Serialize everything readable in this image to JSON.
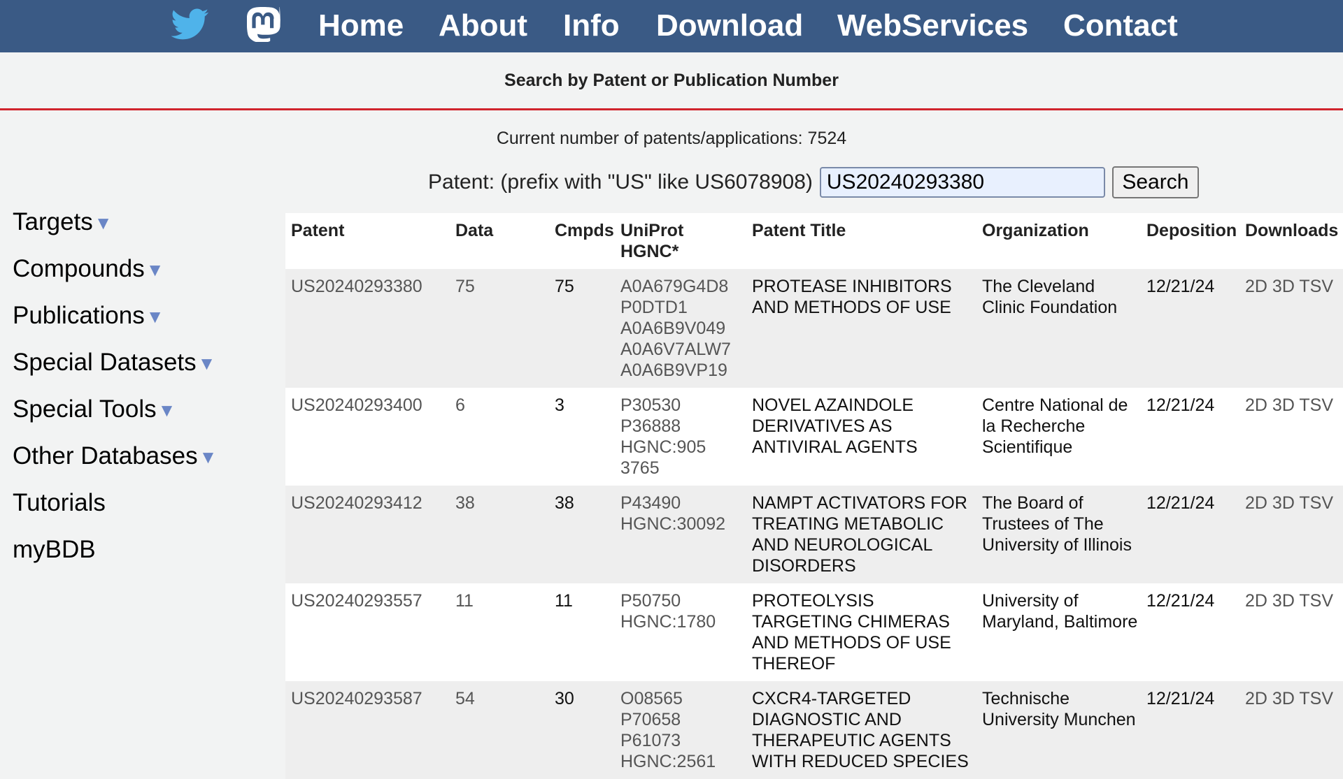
{
  "nav": {
    "icons": [
      "twitter-bird-icon",
      "mastodon-icon"
    ],
    "links": [
      "Home",
      "About",
      "Info",
      "Download",
      "WebServices",
      "Contact"
    ],
    "bg_color": "#3a5a85"
  },
  "subheader": {
    "title": "Search by Patent or Publication Number",
    "accent_color": "#d0242c"
  },
  "count_line": "Current number of patents/applications: 7524",
  "search": {
    "label": "Patent: (prefix with \"US\" like US6078908)",
    "value": "US20240293380",
    "button": "Search"
  },
  "sidebar": {
    "items": [
      {
        "label": "Targets",
        "dropdown": "▼"
      },
      {
        "label": "Compounds",
        "dropdown": "▼"
      },
      {
        "label": "Publications",
        "dropdown": "▼"
      },
      {
        "label": "Special Datasets",
        "dropdown": "▼"
      },
      {
        "label": "Special Tools",
        "dropdown": "▼"
      },
      {
        "label": "Other Databases",
        "dropdown": "▼"
      },
      {
        "label": "Tutorials",
        "dropdown": ""
      },
      {
        "label": "myBDB",
        "dropdown": ""
      }
    ]
  },
  "table": {
    "headers": [
      "Patent",
      "Data",
      "Cmpds",
      "UniProt\nHGNC*",
      "Patent Title",
      "Organization",
      "Deposition",
      "Downloads"
    ],
    "download_links": [
      "2D",
      "3D",
      "TSV"
    ],
    "rows": [
      {
        "patent": "US20240293380",
        "data": "75",
        "cmpds": "75",
        "uniprot": "A0A679G4D8\nP0DTD1\nA0A6B9V049\nA0A6V7ALW7\nA0A6B9VP19",
        "title": "PROTEASE INHIBITORS AND METHODS OF USE",
        "org": "The Cleveland Clinic Foundation",
        "deposition": "12/21/24"
      },
      {
        "patent": "US20240293400",
        "data": "6",
        "cmpds": "3",
        "uniprot": "P30530 P36888\nHGNC:905 3765",
        "title": "NOVEL AZAINDOLE DERIVATIVES AS ANTIVIRAL AGENTS",
        "org": "Centre National de la Recherche Scientifique",
        "deposition": "12/21/24"
      },
      {
        "patent": "US20240293412",
        "data": "38",
        "cmpds": "38",
        "uniprot": "P43490\nHGNC:30092",
        "title": "NAMPT ACTIVATORS FOR TREATING METABOLIC AND NEUROLOGICAL DISORDERS",
        "org": "The Board of Trustees of The University of Illinois",
        "deposition": "12/21/24"
      },
      {
        "patent": "US20240293557",
        "data": "11",
        "cmpds": "11",
        "uniprot": "P50750\nHGNC:1780",
        "title": "PROTEOLYSIS TARGETING CHIMERAS AND METHODS OF USE THEREOF",
        "org": "University of Maryland, Baltimore",
        "deposition": "12/21/24"
      },
      {
        "patent": "US20240293587",
        "data": "54",
        "cmpds": "30",
        "uniprot": "O08565 P70658\nP61073\nHGNC:2561",
        "title": "CXCR4-TARGETED DIAGNOSTIC AND THERAPEUTIC AGENTS WITH REDUCED SPECIES",
        "org": "Technische University Munchen",
        "deposition": "12/21/24"
      }
    ]
  }
}
